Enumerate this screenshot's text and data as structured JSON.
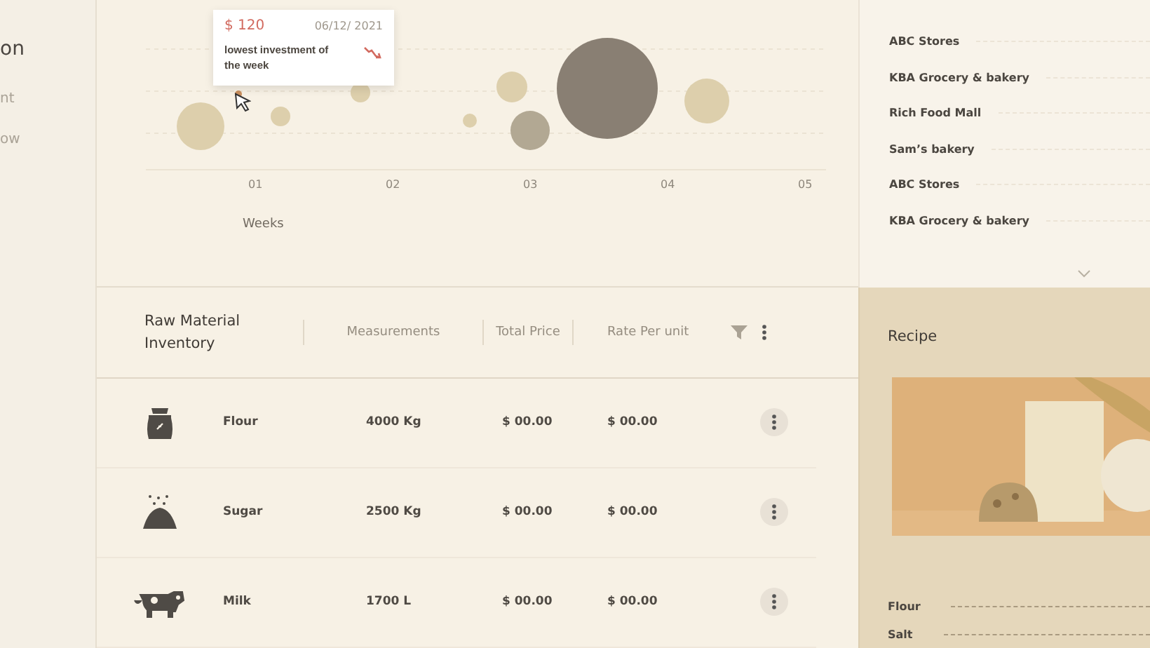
{
  "sidebar": {
    "items": [
      {
        "label": "on",
        "kind": "title"
      },
      {
        "label": "nt",
        "kind": "link"
      },
      {
        "label": "ow",
        "kind": "link"
      }
    ]
  },
  "chart": {
    "x_ticks": [
      "01",
      "02",
      "03",
      "04",
      "05"
    ],
    "xlabel": "Weeks",
    "tooltip": {
      "amount": "$ 120",
      "date": "06/12/ 2021",
      "text": "lowest investment of the week"
    }
  },
  "inventory": {
    "title": "Raw Material Inventory",
    "columns": [
      "Measurements",
      "Total Price",
      "Rate Per unit"
    ],
    "rows": [
      {
        "kind": "flour",
        "name": "Flour",
        "measurement": "4000 Kg",
        "total": "$ 00.00",
        "rate": "$ 00.00"
      },
      {
        "kind": "sugar",
        "name": "Sugar",
        "measurement": "2500 Kg",
        "total": "$ 00.00",
        "rate": "$ 00.00"
      },
      {
        "kind": "milk",
        "name": "Milk",
        "measurement": "1700 L",
        "total": "$ 00.00",
        "rate": "$ 00.00"
      }
    ]
  },
  "stores": [
    "ABC Stores",
    "KBA Grocery & bakery",
    "Rich Food Mall",
    "Sam’s bakery",
    "ABC Stores",
    "KBA Grocery & bakery"
  ],
  "recipe": {
    "title": "Recipe",
    "image": {
      "kind": "picture"
    },
    "ingredients": [
      "Flour",
      "Salt"
    ]
  }
}
